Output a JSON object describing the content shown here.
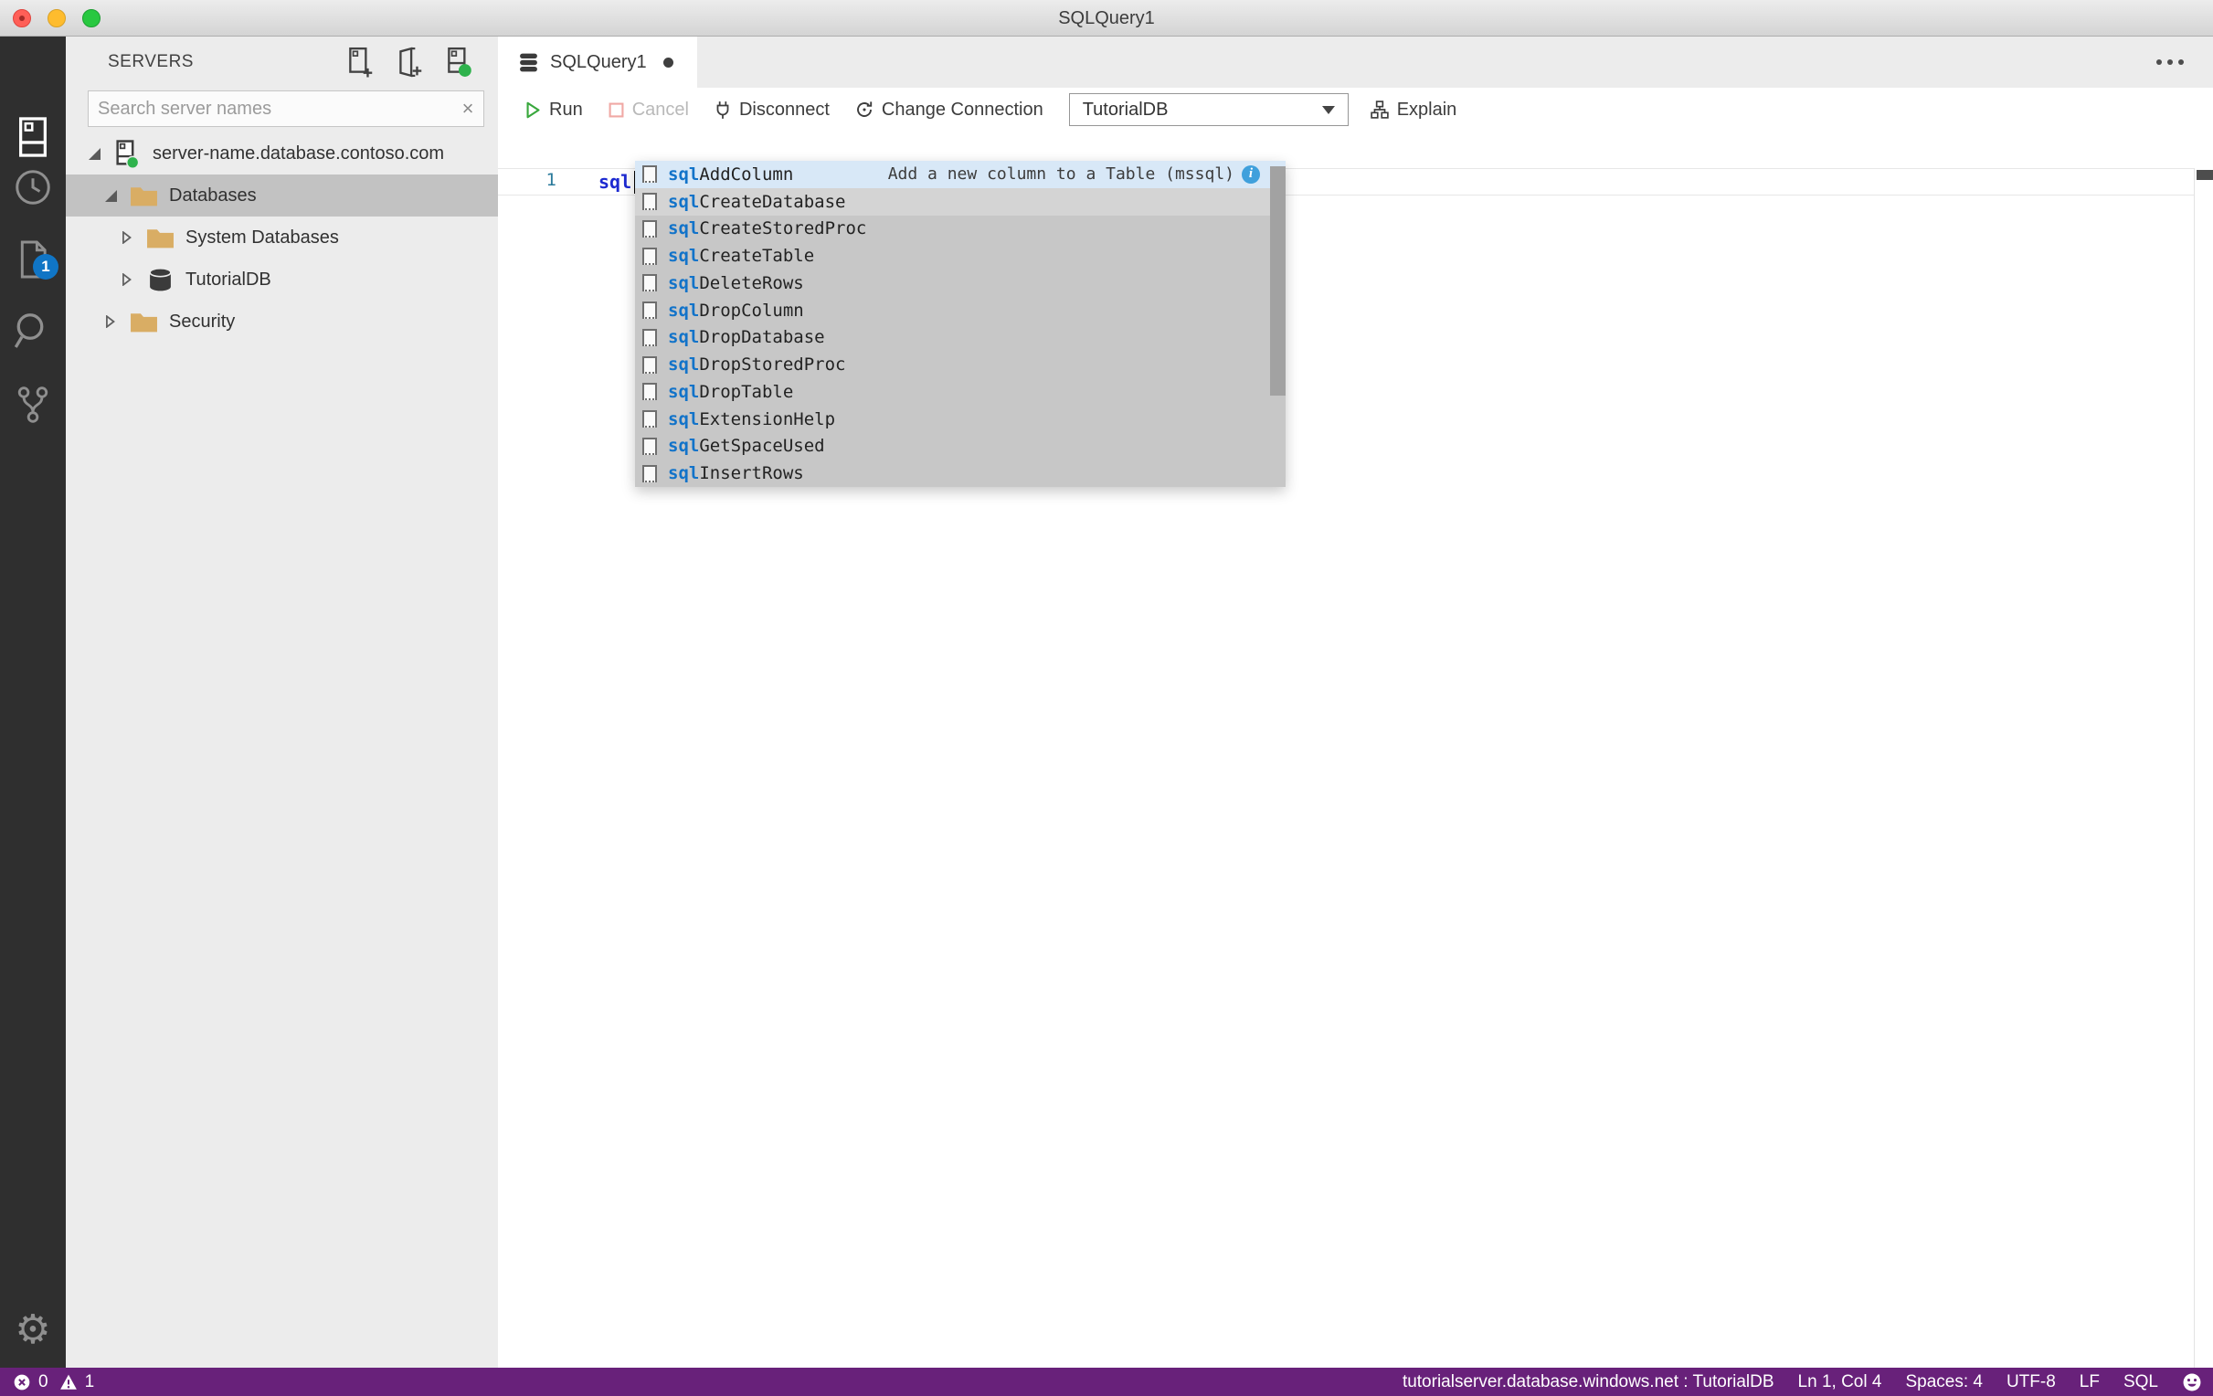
{
  "window": {
    "title": "SQLQuery1"
  },
  "activity_bar": {
    "open_editors_badge": "1"
  },
  "sidebar": {
    "title": "SERVERS",
    "search_placeholder": "Search server names",
    "tree": [
      {
        "label": "server-name.database.contoso.com"
      },
      {
        "label": "Databases"
      },
      {
        "label": "System Databases"
      },
      {
        "label": "TutorialDB"
      },
      {
        "label": "Security"
      }
    ]
  },
  "tab": {
    "title": "SQLQuery1"
  },
  "toolbar": {
    "run": "Run",
    "cancel": "Cancel",
    "disconnect": "Disconnect",
    "change_connection": "Change Connection",
    "database": "TutorialDB",
    "explain": "Explain"
  },
  "editor": {
    "line_number": "1",
    "code": "sql"
  },
  "suggest": {
    "prefix": "sql",
    "selected_detail": "Add a new column to a Table (mssql)",
    "items": [
      {
        "name": "AddColumn"
      },
      {
        "name": "CreateDatabase"
      },
      {
        "name": "CreateStoredProc"
      },
      {
        "name": "CreateTable"
      },
      {
        "name": "DeleteRows"
      },
      {
        "name": "DropColumn"
      },
      {
        "name": "DropDatabase"
      },
      {
        "name": "DropStoredProc"
      },
      {
        "name": "DropTable"
      },
      {
        "name": "ExtensionHelp"
      },
      {
        "name": "GetSpaceUsed"
      },
      {
        "name": "InsertRows"
      }
    ]
  },
  "status_bar": {
    "errors": "0",
    "warnings": "1",
    "connection": "tutorialserver.database.windows.net : TutorialDB",
    "cursor_position": "Ln 1, Col 4",
    "indentation": "Spaces: 4",
    "encoding": "UTF-8",
    "eol": "LF",
    "language": "SQL"
  },
  "colors": {
    "status_bar": "#68217a",
    "badge": "#1075c5",
    "suggest_selected": "#d8e8f7",
    "keyword_blue": "#1d2ad1",
    "match_blue": "#1273c9",
    "folder_tan": "#d9ad64",
    "connected_green": "#2eb24c"
  }
}
